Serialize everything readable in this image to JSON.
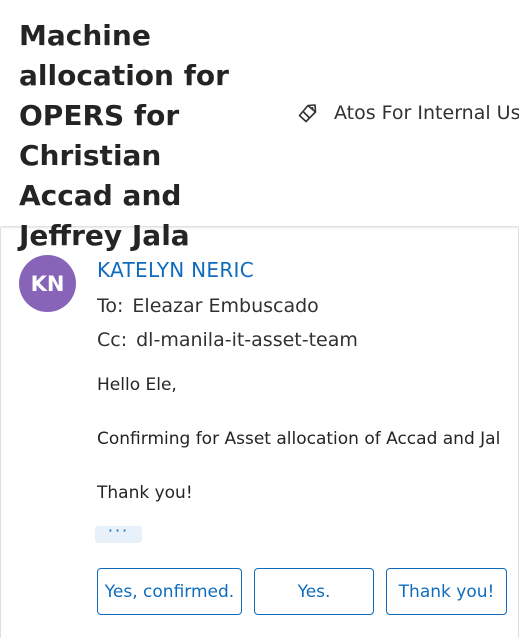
{
  "email": {
    "subject": "Machine allocation for OPERS for Christian Accad and Jeffrey Jala",
    "sensitivity_label": "Atos For Internal Use",
    "sensitivity_icon": "tag-label-icon"
  },
  "message": {
    "avatar_initials": "KN",
    "avatar_color": "#8764b8",
    "sender": "KATELYN NERIC",
    "to_label": "To:",
    "to": "Eleazar Embuscado",
    "cc_label": "Cc:",
    "cc": "dl-manila-it-asset-team",
    "body": [
      "Hello Ele,",
      "Confirming for Asset allocation of Accad and Jal",
      "Thank you!"
    ],
    "show_more": "···"
  },
  "quick_replies": [
    "Yes, confirmed.",
    "Yes.",
    "Thank you!"
  ],
  "colors": {
    "accent": "#0f6cbd",
    "divider": "#e1dfdd"
  }
}
